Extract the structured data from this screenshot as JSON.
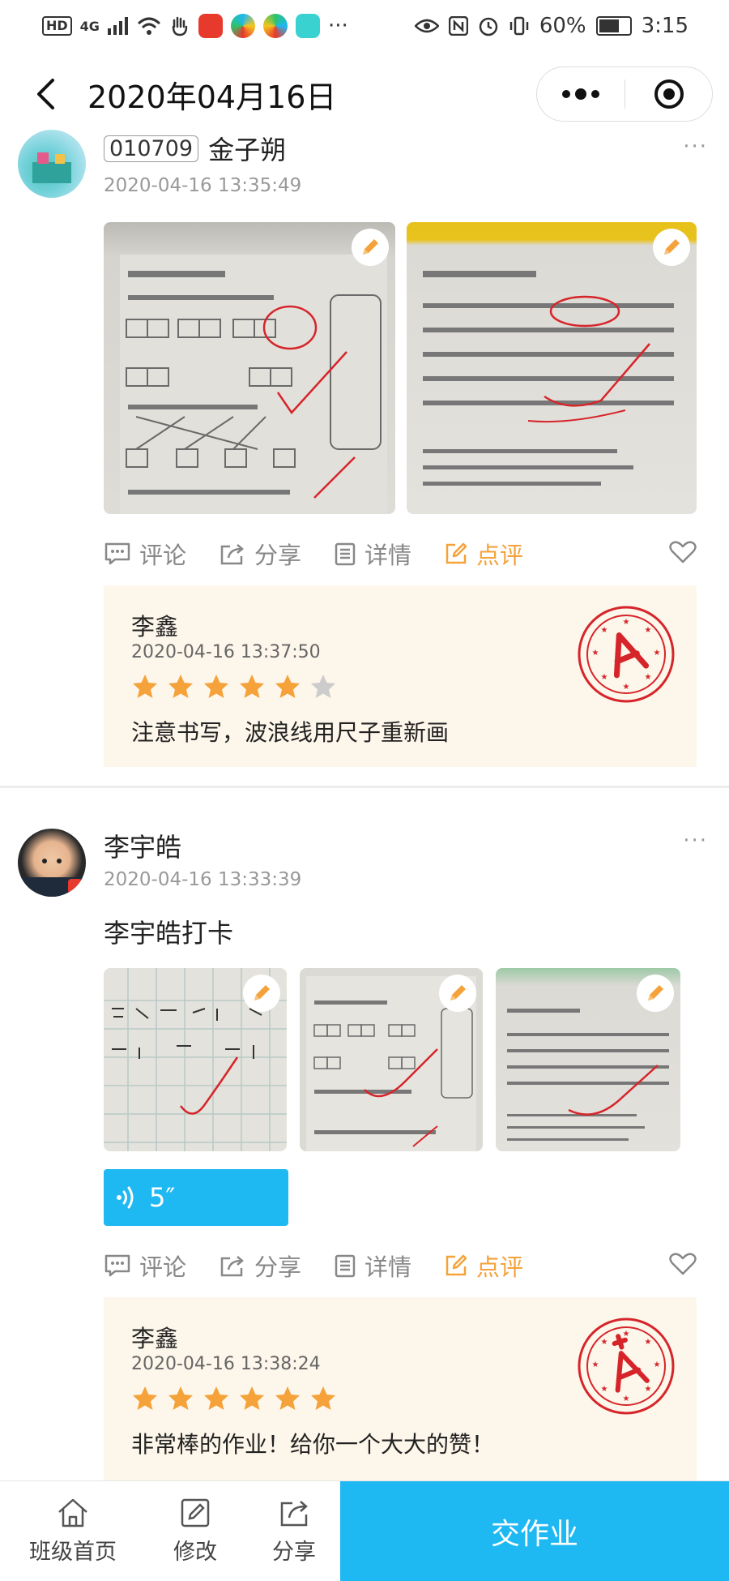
{
  "status_bar": {
    "left_badges": [
      "HD",
      "4G"
    ],
    "battery": "60%",
    "time": "3:15",
    "more": "···"
  },
  "nav": {
    "title": "2020年04月16日"
  },
  "posts": [
    {
      "id_badge": "010709",
      "name": "金子朔",
      "time": "2020-04-16 13:35:49",
      "more": "···",
      "actions": {
        "comment": "评论",
        "share": "分享",
        "detail": "详情",
        "review": "点评"
      },
      "review": {
        "reviewer": "李鑫",
        "time": "2020-04-16 13:37:50",
        "rating": 5,
        "max_rating": 6,
        "comment": "注意书写，波浪线用尺子重新画"
      }
    },
    {
      "name": "李宇皓",
      "time": "2020-04-16 13:33:39",
      "more": "···",
      "text": "李宇皓打卡",
      "audio_duration": "5″",
      "actions": {
        "comment": "评论",
        "share": "分享",
        "detail": "详情",
        "review": "点评"
      },
      "review": {
        "reviewer": "李鑫",
        "time": "2020-04-16 13:38:24",
        "rating": 6,
        "max_rating": 6,
        "comment": "非常棒的作业！给你一个大大的赞！"
      }
    }
  ],
  "bottom_bar": {
    "tabs": [
      {
        "label": "班级首页",
        "icon": "home-icon"
      },
      {
        "label": "修改",
        "icon": "edit-icon"
      },
      {
        "label": "分享",
        "icon": "share-icon"
      }
    ],
    "submit": "交作业"
  },
  "colors": {
    "accent": "#1eb8f3",
    "review": "#f5a23a",
    "star": "#f5a23a",
    "star_empty": "#cccccc",
    "stamp": "#d6252a",
    "card_bg": "#fdf6ea"
  }
}
